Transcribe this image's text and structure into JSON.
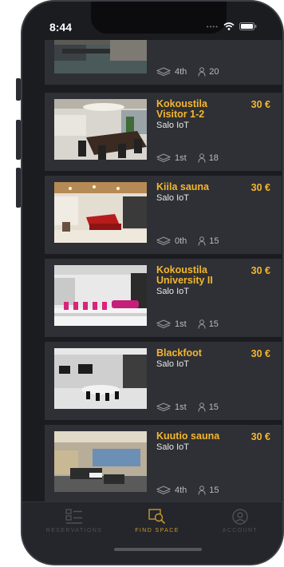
{
  "status_bar": {
    "time": "8:44"
  },
  "listings": [
    {
      "title": "",
      "price": "",
      "subtitle": "",
      "floor": "4th",
      "capacity": "20"
    },
    {
      "title": "Kokoustila Visitor 1-2",
      "price": "30 €",
      "subtitle": "Salo IoT",
      "floor": "1st",
      "capacity": "18"
    },
    {
      "title": "Kiila sauna",
      "price": "30 €",
      "subtitle": "Salo IoT",
      "floor": "0th",
      "capacity": "15"
    },
    {
      "title": "Kokoustila University II",
      "price": "30 €",
      "subtitle": "Salo IoT",
      "floor": "1st",
      "capacity": "15"
    },
    {
      "title": "Blackfoot",
      "price": "30 €",
      "subtitle": "Salo IoT",
      "floor": "1st",
      "capacity": "15"
    },
    {
      "title": "Kuutio sauna",
      "price": "30 €",
      "subtitle": "Salo IoT",
      "floor": "4th",
      "capacity": "15"
    }
  ],
  "tabs": [
    {
      "label": "RESERVATIONS",
      "icon": "list-icon",
      "active": false
    },
    {
      "label": "FIND SPACE",
      "icon": "search-icon",
      "active": true
    },
    {
      "label": "ACCOUNT",
      "icon": "account-icon",
      "active": false
    }
  ],
  "colors": {
    "accent": "#f5b62d",
    "card": "#2e3035",
    "background": "#1b1c20"
  }
}
